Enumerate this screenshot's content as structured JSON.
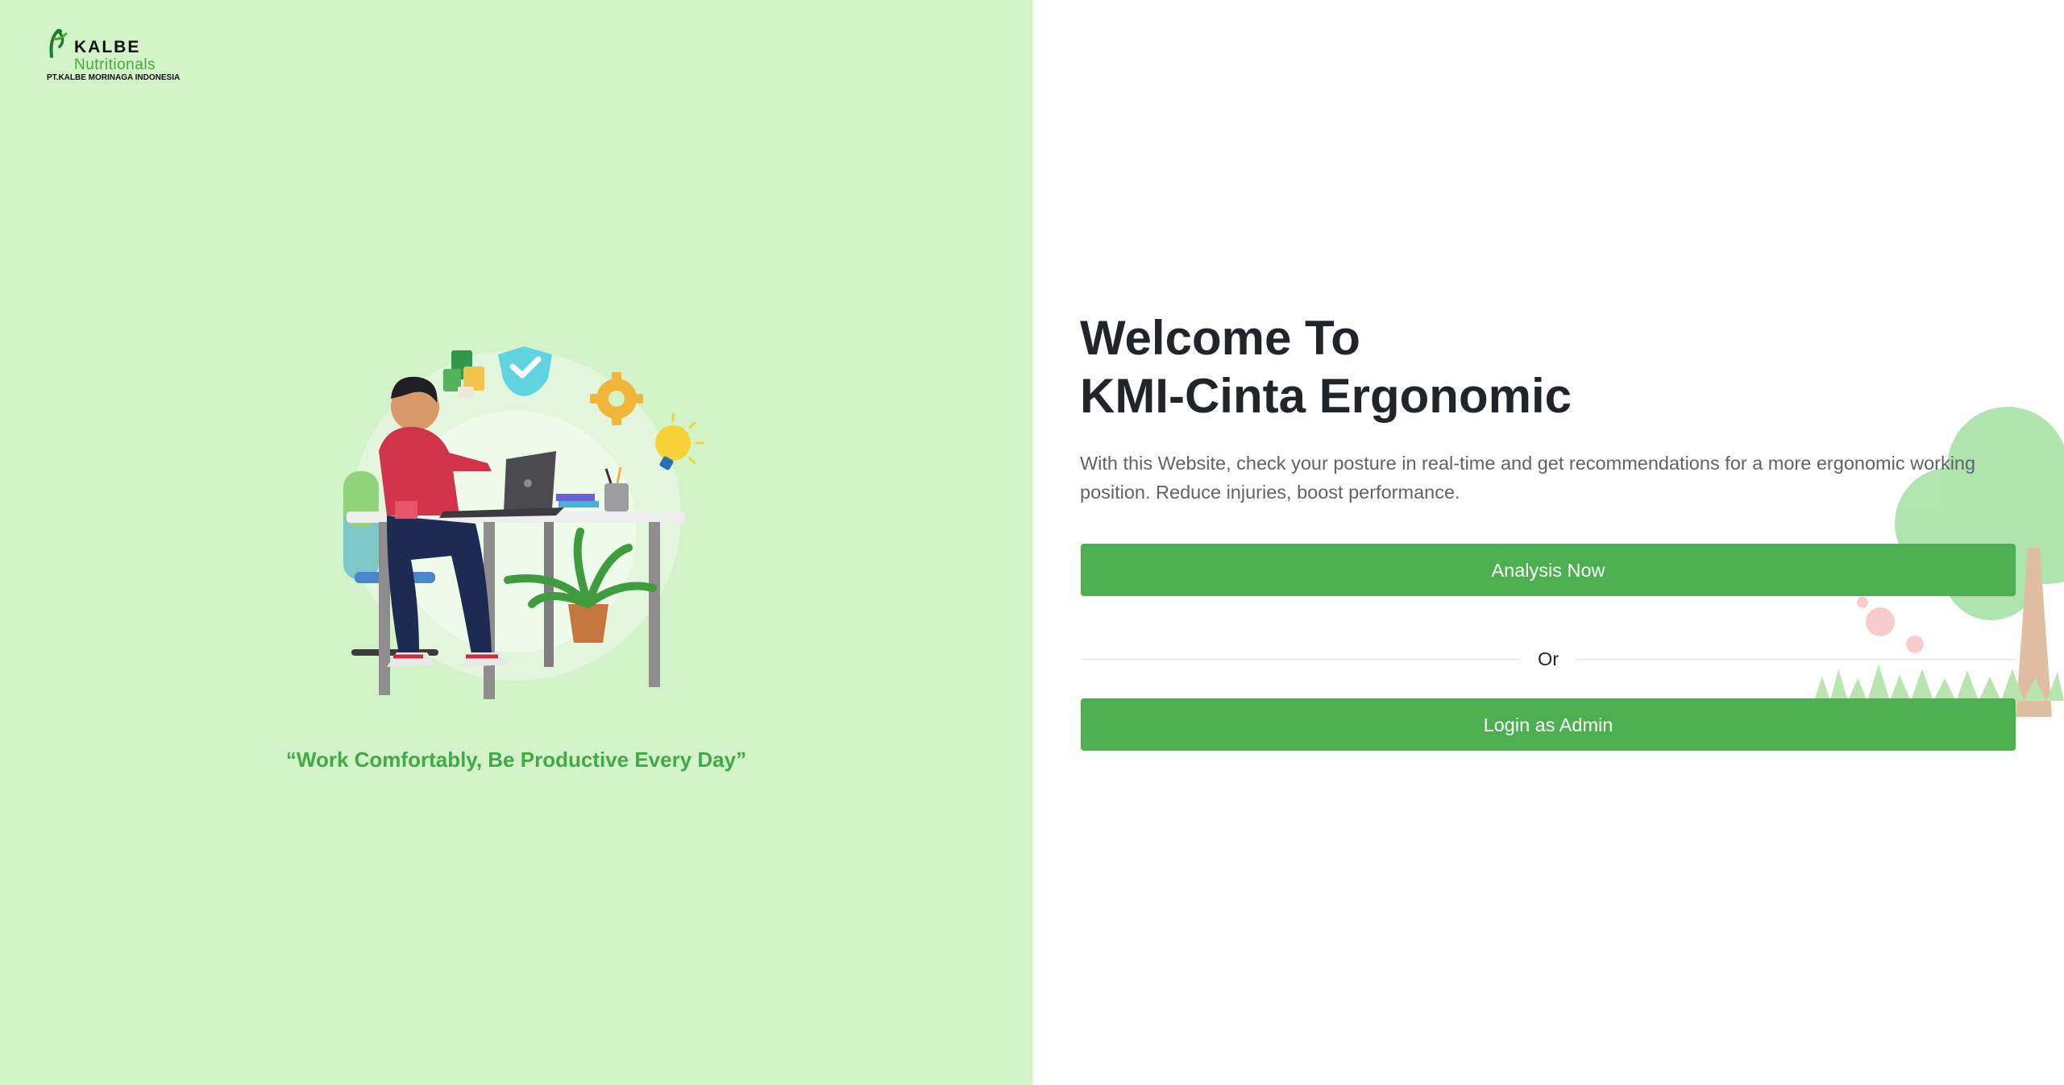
{
  "brand": {
    "name": "KALBE",
    "sub": "Nutritionals",
    "company": "PT.KALBE MORINAGA INDONESIA"
  },
  "hero": {
    "tagline": "“Work Comfortably, Be Productive Every Day”"
  },
  "welcome": {
    "line1": "Welcome To",
    "line2": "KMI-Cinta Ergonomic",
    "description": "With this Website, check your posture in real-time and get recommendations for a more ergonomic working position. Reduce injuries, boost performance."
  },
  "actions": {
    "analysis_label": "Analysis Now",
    "divider_label": "Or",
    "admin_label": "Login as Admin"
  },
  "colors": {
    "left_panel_bg": "#d2f3c8",
    "primary_button": "#4caf50",
    "tagline": "#43a947",
    "heading": "#212529",
    "body_text": "#5f6368"
  },
  "icons": {
    "logo": "kalbe-logo-icon",
    "illustration": "ergonomic-worker-illustration",
    "scenery": "tree-scenery-illustration"
  }
}
